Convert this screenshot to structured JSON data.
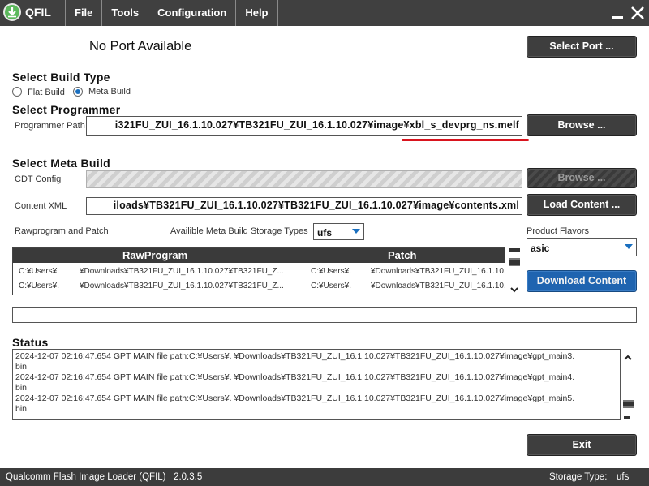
{
  "app": {
    "name": "QFIL",
    "menu": [
      "File",
      "Tools",
      "Configuration",
      "Help"
    ]
  },
  "port": {
    "status": "No Port Available",
    "select_button": "Select Port ..."
  },
  "build_type": {
    "heading": "Select Build Type",
    "options": [
      {
        "label": "Flat Build",
        "selected": false
      },
      {
        "label": "Meta Build",
        "selected": true
      }
    ]
  },
  "programmer": {
    "heading": "Select Programmer",
    "path_label": "Programmer Path",
    "path_value": "i321FU_ZUI_16.1.10.027¥TB321FU_ZUI_16.1.10.027¥image¥xbl_s_devprg_ns.melf",
    "browse_button": "Browse ..."
  },
  "meta_build": {
    "heading": "Select Meta Build",
    "cdt_label": "CDT Config",
    "cdt_browse_button": "Browse ...",
    "content_xml_label": "Content XML",
    "content_xml_value": "iloads¥TB321FU_ZUI_16.1.10.027¥TB321FU_ZUI_16.1.10.027¥image¥contents.xml",
    "load_button": "Load Content ...",
    "rawprogram_label": "Rawprogram and Patch",
    "storage_label": "Availible Meta Build Storage Types",
    "storage_value": "ufs",
    "flavors_label": "Product Flavors",
    "flavor_value": "asic",
    "download_button": "Download Content"
  },
  "table": {
    "columns": [
      "RawProgram",
      "Patch"
    ],
    "rows": [
      {
        "raw_a": "C:¥Users¥.",
        "raw_b": "¥Downloads¥TB321FU_ZUI_16.1.10.027¥TB321FU_Z...",
        "patch_a": "C:¥Users¥.",
        "patch_b": "¥Downloads¥TB321FU_ZUI_16.1.10.027¥TB321FU_ZUI_1..."
      },
      {
        "raw_a": "C:¥Users¥.",
        "raw_b": "¥Downloads¥TB321FU_ZUI_16.1.10.027¥TB321FU_Z...",
        "patch_a": "C:¥Users¥.",
        "patch_b": "¥Downloads¥TB321FU_ZUI_16.1.10.027¥TB321FU_ZUI_1..."
      }
    ]
  },
  "status": {
    "heading": "Status",
    "log": [
      {
        "time": "2024-12-07 02:16:47.654",
        "msg": "GPT MAIN file path:C:¥Users¥.",
        "path": "¥Downloads¥TB321FU_ZUI_16.1.10.027¥TB321FU_ZUI_16.1.10.027¥image¥gpt_main3.",
        "tail": "bin"
      },
      {
        "time": "2024-12-07 02:16:47.654",
        "msg": "GPT MAIN file path:C:¥Users¥.",
        "path": "¥Downloads¥TB321FU_ZUI_16.1.10.027¥TB321FU_ZUI_16.1.10.027¥image¥gpt_main4.",
        "tail": "bin"
      },
      {
        "time": "2024-12-07 02:16:47.654",
        "msg": "GPT MAIN file path:C:¥Users¥.",
        "path": "¥Downloads¥TB321FU_ZUI_16.1.10.027¥TB321FU_ZUI_16.1.10.027¥image¥gpt_main5.",
        "tail": "bin"
      }
    ]
  },
  "exit_button": "Exit",
  "statusbar": {
    "app_version": "Qualcomm Flash Image Loader (QFIL)   2.0.3.5",
    "storage_label": "Storage Type:",
    "storage_value": "ufs"
  },
  "colors": {
    "titlebar": "#404040",
    "button": "#3e3e3e",
    "accent_blue": "#1f64b0",
    "highlight_underline": "#d9141e"
  }
}
